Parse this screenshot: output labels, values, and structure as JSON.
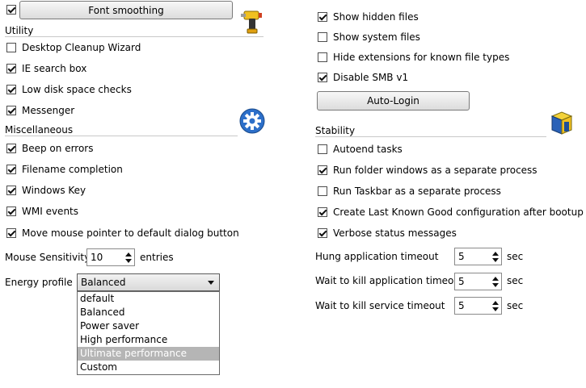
{
  "left": {
    "top_checkbox": {
      "checked": true
    },
    "font_smoothing_button": "Font smoothing",
    "utility": {
      "title": "Utility",
      "items": [
        {
          "label": "Desktop Cleanup Wizard",
          "checked": false
        },
        {
          "label": "IE search box",
          "checked": true
        },
        {
          "label": "Low disk space checks",
          "checked": true
        },
        {
          "label": "Messenger",
          "checked": true
        }
      ]
    },
    "miscellaneous": {
      "title": "Miscellaneous",
      "items": [
        {
          "label": "Beep on errors",
          "checked": true
        },
        {
          "label": "Filename completion",
          "checked": true
        },
        {
          "label": "Windows Key",
          "checked": true
        },
        {
          "label": "WMI events",
          "checked": true
        },
        {
          "label": "Move mouse pointer to default dialog button",
          "checked": true
        }
      ]
    },
    "mouse_sensitivity": {
      "label": "Mouse Sensitivity",
      "value": "10",
      "unit": "entries"
    },
    "energy_profile": {
      "label": "Energy profile",
      "selected": "Balanced",
      "options": [
        "default",
        "Balanced",
        "Power saver",
        "High performance",
        "Ultimate performance",
        "Custom"
      ],
      "highlighted": "Ultimate performance"
    }
  },
  "right": {
    "explorer_items": [
      {
        "label": "Show hidden files",
        "checked": true
      },
      {
        "label": "Show system files",
        "checked": false
      },
      {
        "label": "Hide extensions for known file types",
        "checked": false
      },
      {
        "label": "Disable SMB v1",
        "checked": true
      }
    ],
    "auto_login_button": "Auto-Login",
    "stability": {
      "title": "Stability",
      "items": [
        {
          "label": "Autoend tasks",
          "checked": false
        },
        {
          "label": "Run folder windows as a separate process",
          "checked": true
        },
        {
          "label": "Run Taskbar as a separate process",
          "checked": false
        },
        {
          "label": "Create Last Known Good configuration after bootup",
          "checked": true
        },
        {
          "label": "Verbose status messages",
          "checked": true
        }
      ]
    },
    "timeouts": [
      {
        "label": "Hung application timeout",
        "value": "5",
        "unit": "sec"
      },
      {
        "label": "Wait to kill application timeout",
        "value": "5",
        "unit": "sec"
      },
      {
        "label": "Wait to kill service timeout",
        "value": "5",
        "unit": "sec"
      }
    ]
  },
  "icons": {
    "utility": "drill-icon",
    "miscellaneous": "gear-icon",
    "stability": "cube-icon"
  }
}
